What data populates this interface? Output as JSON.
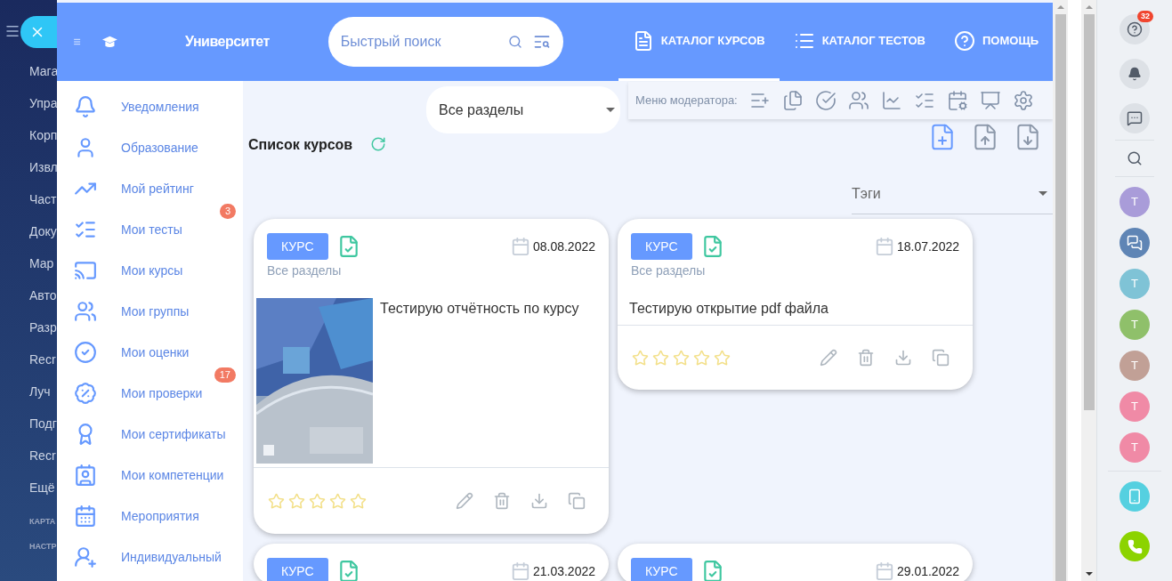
{
  "background_menu": {
    "items": [
      "Мага",
      "Упра",
      "Корп",
      "Извл",
      "Част",
      "Доку",
      "Мар",
      "Авто",
      "Разр",
      "Recr",
      "Луч",
      "Подг",
      "Recr",
      "Ещё"
    ],
    "sections": [
      "КАРТА",
      "НАСТР"
    ]
  },
  "header": {
    "title": "Университет",
    "search": {
      "placeholder": "Быстрый поиск"
    },
    "nav": [
      {
        "label": "КАТАЛОГ КУРСОВ",
        "selected": true
      },
      {
        "label": "КАТАЛОГ ТЕСТОВ",
        "selected": false
      },
      {
        "label": "ПОМОЩЬ",
        "selected": false
      }
    ]
  },
  "sidebar": {
    "items": [
      {
        "label": "Уведомления"
      },
      {
        "label": "Образование"
      },
      {
        "label": "Мой рейтинг"
      },
      {
        "label": "Мои тесты",
        "badge": "3"
      },
      {
        "label": "Мои курсы"
      },
      {
        "label": "Мои группы"
      },
      {
        "label": "Мои оценки"
      },
      {
        "label": "Мои проверки",
        "badge": "17"
      },
      {
        "label": "Мои сертификаты"
      },
      {
        "label": "Мои компетенции"
      },
      {
        "label": "Мероприятия"
      },
      {
        "label": "Индивидуальный"
      }
    ]
  },
  "section_select": {
    "value": "Все разделы"
  },
  "moderator_menu": {
    "label": "Меню модератора:"
  },
  "list_title": "Список курсов",
  "tags_select": {
    "placeholder": "Тэги"
  },
  "cards": [
    {
      "badge": "КУРС",
      "date": "08.08.2022",
      "section": "Все разделы",
      "title": "Тестирую отчётность по курсу",
      "stars": 0
    },
    {
      "badge": "КУРС",
      "date": "18.07.2022",
      "section": "Все разделы",
      "title": "Тестирую открытие pdf файла",
      "stars": 0
    },
    {
      "badge": "КУРС",
      "date": "21.03.2022"
    },
    {
      "badge": "КУРС",
      "date": "29.01.2022"
    }
  ],
  "right_panel": {
    "help_badge": "32",
    "contacts": [
      {
        "kind": "avatar",
        "initial": "Т",
        "color": "#a99cd9"
      },
      {
        "kind": "group"
      },
      {
        "kind": "avatar",
        "initial": "Т",
        "color": "#7fc3d6"
      },
      {
        "kind": "avatar",
        "initial": "Т",
        "color": "#8fc06a"
      },
      {
        "kind": "avatar",
        "initial": "Т",
        "color": "#c1a096"
      },
      {
        "kind": "avatar",
        "initial": "Т",
        "color": "#f08aa6"
      },
      {
        "kind": "avatar",
        "initial": "Т",
        "color": "#f08aa6"
      }
    ]
  }
}
